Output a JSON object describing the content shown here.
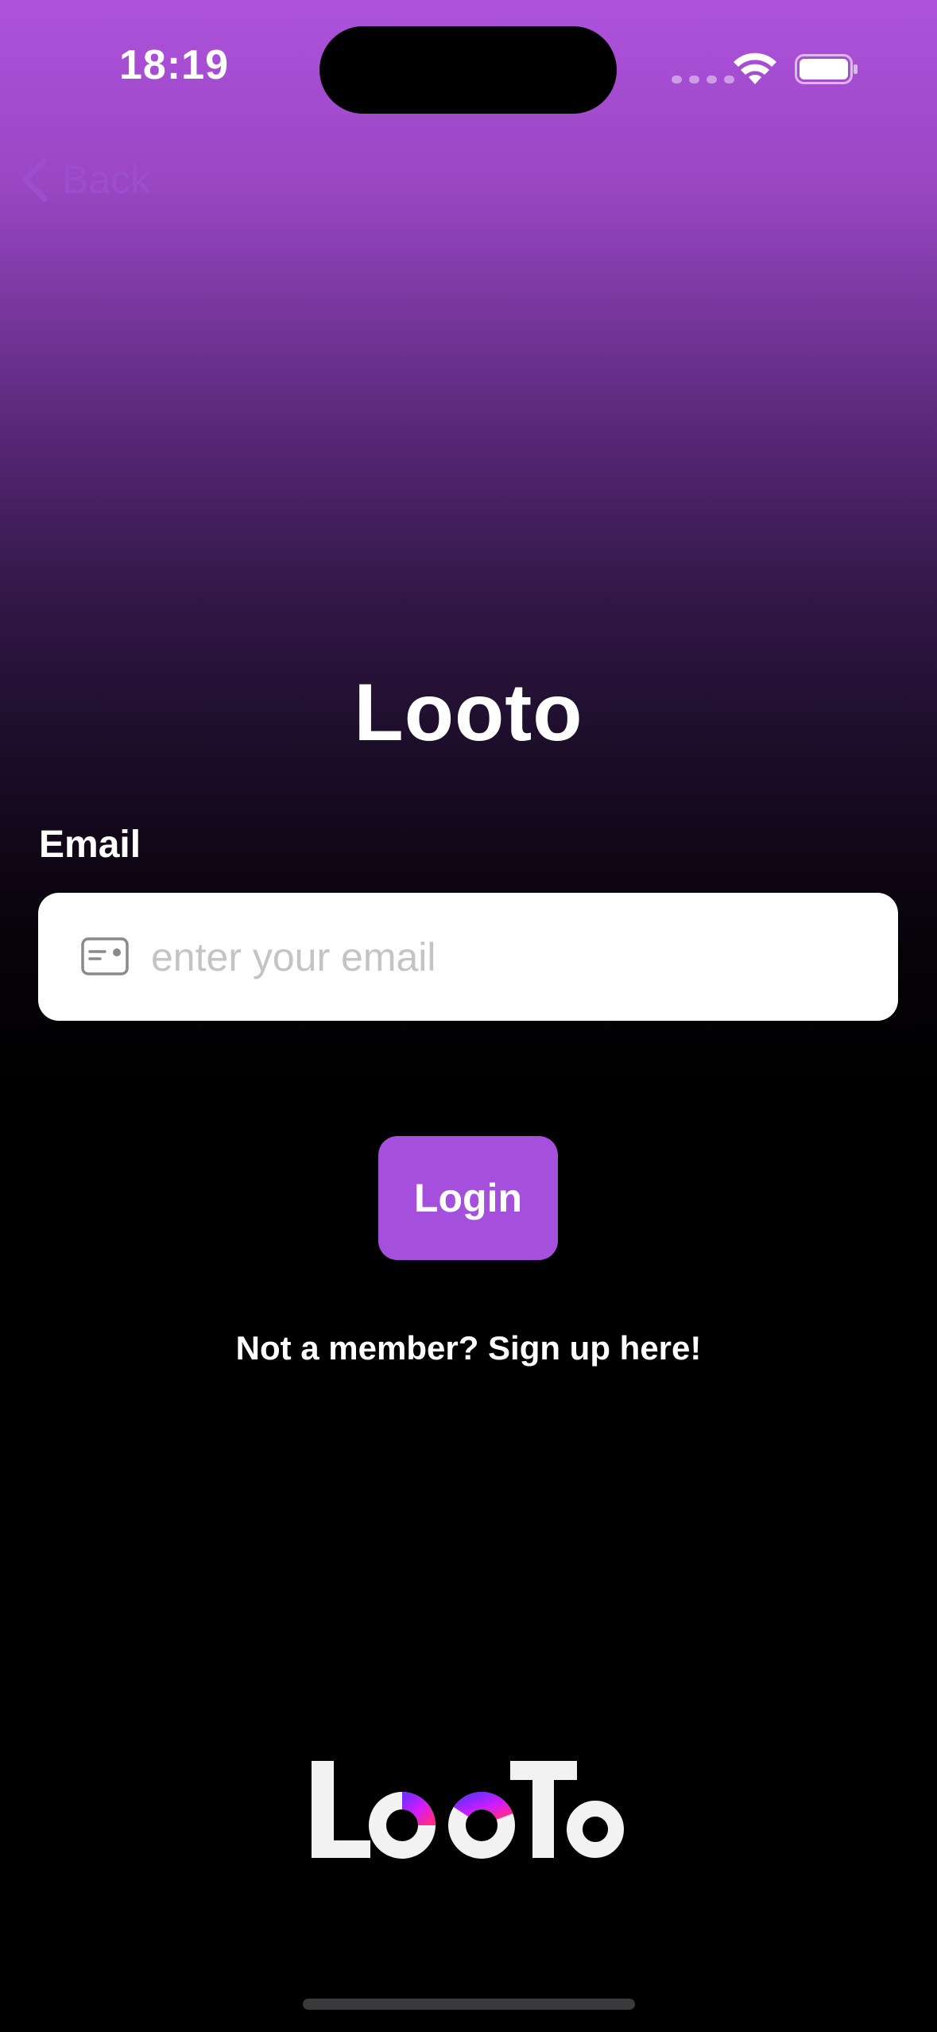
{
  "status_bar": {
    "time": "18:19",
    "signal_icon": "cellular-signal-dots",
    "wifi_icon": "wifi-icon",
    "battery_icon": "battery-icon"
  },
  "nav": {
    "back_label": "Back",
    "back_icon": "chevron-left-icon"
  },
  "app": {
    "title": "Looto",
    "logo_text": "LooTo"
  },
  "form": {
    "email_label": "Email",
    "email_placeholder": "enter your email",
    "email_value": "",
    "email_icon": "id-card-icon",
    "login_label": "Login",
    "signup_text": "Not a member? Sign up here!"
  },
  "colors": {
    "accent": "#a550dc",
    "gradient_top": "#ae52dc",
    "background": "#000000",
    "back_text": "#9c4ecf"
  }
}
